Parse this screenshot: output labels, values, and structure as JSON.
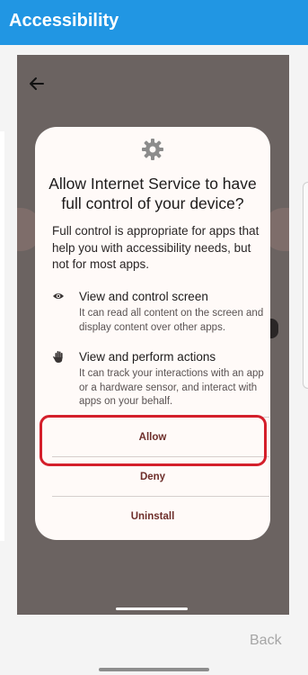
{
  "appbar": {
    "title": "Accessibility"
  },
  "dialog": {
    "title": "Allow Internet Service to have full control of your device?",
    "body": "Full control is appropriate for apps that help you with accessibility needs, but not for most apps.",
    "permissions": [
      {
        "icon": "eye-icon",
        "title": "View and control screen",
        "description": "It can read all content on the screen and display content over other apps."
      },
      {
        "icon": "hand-icon",
        "title": "View and perform actions",
        "description": "It can track your interactions with an app or a hardware sensor, and interact with apps on your behalf."
      }
    ],
    "buttons": {
      "allow": "Allow",
      "deny": "Deny",
      "uninstall": "Uninstall"
    }
  },
  "footer": {
    "back": "Back"
  },
  "colors": {
    "appbar": "#2196e3",
    "highlight": "#d41f2b",
    "button_text": "#6d2e2a"
  }
}
